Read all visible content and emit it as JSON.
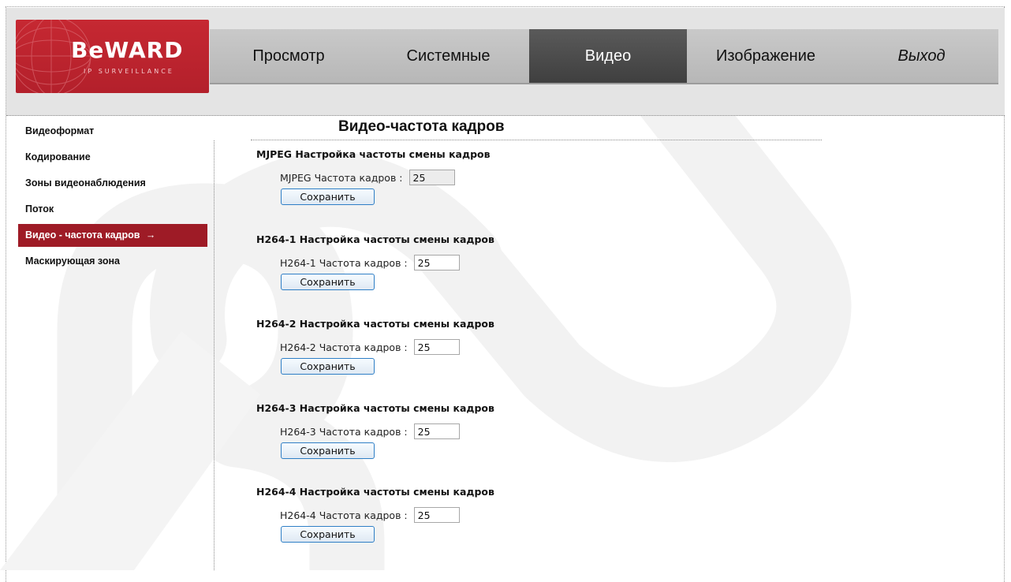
{
  "brand": {
    "name": "BeWARD",
    "tagline": "IP SURVEILLANCE",
    "color": "#b3202b"
  },
  "nav": {
    "items": [
      {
        "label": "Просмотр",
        "active": false
      },
      {
        "label": "Системные",
        "active": false
      },
      {
        "label": "Видео",
        "active": true
      },
      {
        "label": "Изображение",
        "active": false
      },
      {
        "label": "Выход",
        "active": false
      }
    ]
  },
  "sidebar": {
    "items": [
      {
        "label": "Видеоформат"
      },
      {
        "label": "Кодирование"
      },
      {
        "label": "Зоны видеонаблюдения"
      },
      {
        "label": "Поток"
      },
      {
        "label": "Видео - частота кадров",
        "active": true,
        "arrow": "→"
      },
      {
        "label": "Маскирующая зона"
      }
    ]
  },
  "main": {
    "title": "Видео-частота кадров",
    "sections": [
      {
        "heading": "MJPEG Настройка частоты смены кадров",
        "label": "MJPEG Частота кадров :",
        "value": "25",
        "readonly": true,
        "button": "Сохранить"
      },
      {
        "heading": "H264-1 Настройка частоты смены кадров",
        "label": "H264-1 Частота кадров :",
        "value": "25",
        "readonly": false,
        "button": "Сохранить"
      },
      {
        "heading": "H264-2 Настройка частоты смены кадров",
        "label": "H264-2 Частота кадров :",
        "value": "25",
        "readonly": false,
        "button": "Сохранить"
      },
      {
        "heading": "H264-3 Настройка частоты смены кадров",
        "label": "H264-3 Частота кадров :",
        "value": "25",
        "readonly": false,
        "button": "Сохранить"
      },
      {
        "heading": "H264-4 Настройка частоты смены кадров",
        "label": "H264-4 Частота кадров :",
        "value": "25",
        "readonly": false,
        "button": "Сохранить"
      }
    ]
  },
  "colors": {
    "accent": "#9e1b26",
    "nav_active": "#4a4a4a",
    "button_border": "#2f7fc6"
  }
}
